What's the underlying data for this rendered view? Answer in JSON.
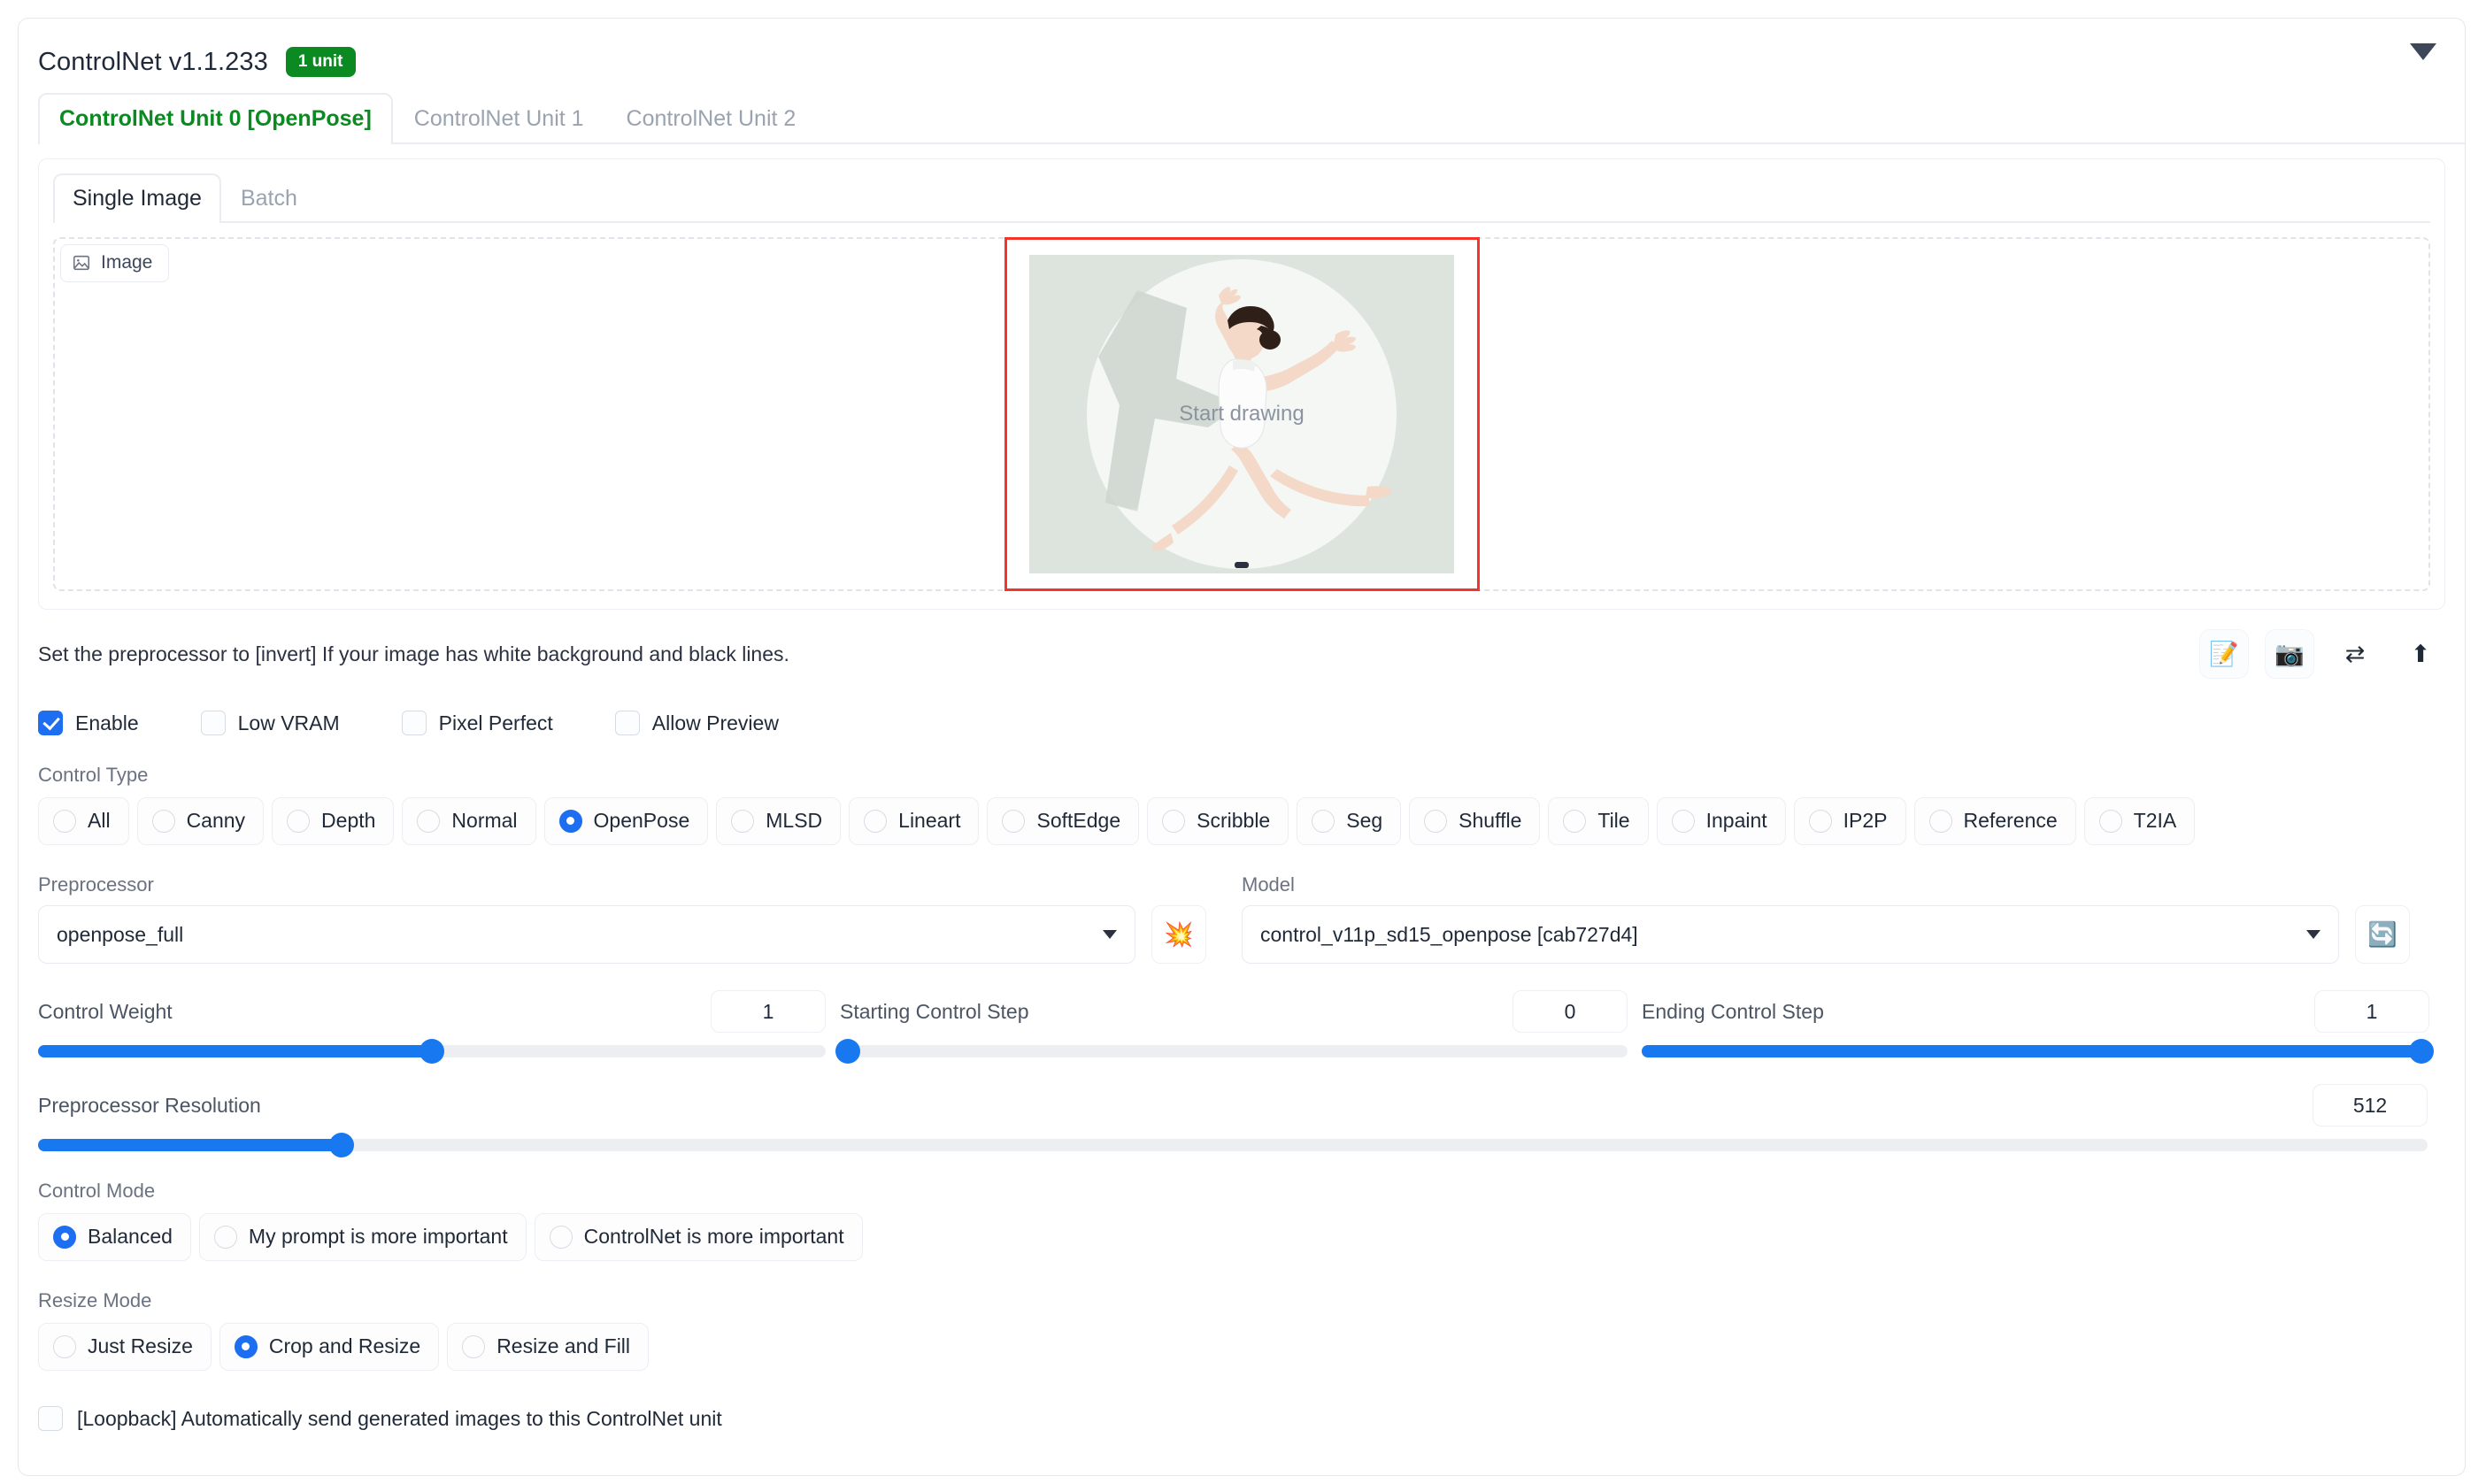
{
  "header": {
    "title": "ControlNet v1.1.233",
    "unit_badge": "1 unit",
    "collapse_icon": "chevron-down-icon"
  },
  "unit_tabs": [
    {
      "label": "ControlNet Unit 0 [OpenPose]",
      "active": true
    },
    {
      "label": "ControlNet Unit 1",
      "active": false
    },
    {
      "label": "ControlNet Unit 2",
      "active": false
    }
  ],
  "sub_tabs": [
    {
      "label": "Single Image",
      "active": true
    },
    {
      "label": "Batch",
      "active": false
    }
  ],
  "dropzone": {
    "chip_label": "Image",
    "chip_icon": "image-icon",
    "canvas_overlay_text": "Start drawing",
    "border_color": "#f5342b"
  },
  "hint": {
    "text": "Set the preprocessor to [invert] If your image has white background and black lines."
  },
  "icon_buttons": [
    {
      "name": "edit-memo-icon",
      "glyph": "📝"
    },
    {
      "name": "camera-icon",
      "glyph": "📷"
    },
    {
      "name": "swap-arrows-icon",
      "glyph": "⇄"
    },
    {
      "name": "upload-arrow-icon",
      "glyph": "⬆"
    }
  ],
  "checkboxes": [
    {
      "label": "Enable",
      "checked": true
    },
    {
      "label": "Low VRAM",
      "checked": false
    },
    {
      "label": "Pixel Perfect",
      "checked": false
    },
    {
      "label": "Allow Preview",
      "checked": false
    }
  ],
  "control_type": {
    "label": "Control Type",
    "options": [
      {
        "label": "All",
        "selected": false
      },
      {
        "label": "Canny",
        "selected": false
      },
      {
        "label": "Depth",
        "selected": false
      },
      {
        "label": "Normal",
        "selected": false
      },
      {
        "label": "OpenPose",
        "selected": true
      },
      {
        "label": "MLSD",
        "selected": false
      },
      {
        "label": "Lineart",
        "selected": false
      },
      {
        "label": "SoftEdge",
        "selected": false
      },
      {
        "label": "Scribble",
        "selected": false
      },
      {
        "label": "Seg",
        "selected": false
      },
      {
        "label": "Shuffle",
        "selected": false
      },
      {
        "label": "Tile",
        "selected": false
      },
      {
        "label": "Inpaint",
        "selected": false
      },
      {
        "label": "IP2P",
        "selected": false
      },
      {
        "label": "Reference",
        "selected": false
      },
      {
        "label": "T2IA",
        "selected": false
      }
    ]
  },
  "preprocessor": {
    "label": "Preprocessor",
    "value": "openpose_full",
    "run_icon": "explosion-icon",
    "run_glyph": "💥"
  },
  "model": {
    "label": "Model",
    "value": "control_v11p_sd15_openpose [cab727d4]",
    "refresh_icon": "refresh-icon",
    "refresh_glyph": "🔄"
  },
  "sliders": [
    {
      "label": "Control Weight",
      "value": "1",
      "percent": 50
    },
    {
      "label": "Starting Control Step",
      "value": "0",
      "percent": 0
    },
    {
      "label": "Ending Control Step",
      "value": "1",
      "percent": 100
    },
    {
      "label": "Preprocessor Resolution",
      "value": "512",
      "percent": 23
    }
  ],
  "control_mode": {
    "label": "Control Mode",
    "options": [
      {
        "label": "Balanced",
        "selected": true
      },
      {
        "label": "My prompt is more important",
        "selected": false
      },
      {
        "label": "ControlNet is more important",
        "selected": false
      }
    ]
  },
  "resize_mode": {
    "label": "Resize Mode",
    "options": [
      {
        "label": "Just Resize",
        "selected": false
      },
      {
        "label": "Crop and Resize",
        "selected": true
      },
      {
        "label": "Resize and Fill",
        "selected": false
      }
    ]
  },
  "loopback": {
    "label": "[Loopback] Automatically send generated images to this ControlNet unit",
    "checked": false
  },
  "colors": {
    "accent_blue": "#1878f0",
    "badge_green": "#0b8a22",
    "active_tab_green": "#0b8a22",
    "canvas_border_red": "#f5342b"
  }
}
